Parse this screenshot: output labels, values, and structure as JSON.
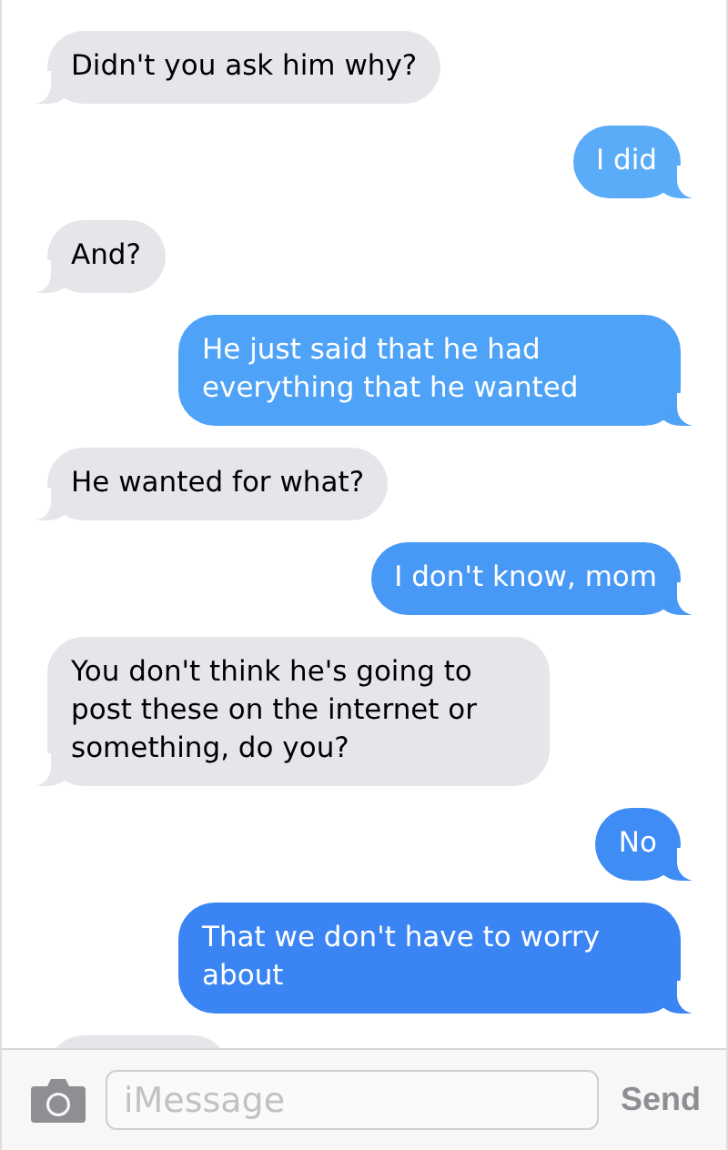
{
  "messages": [
    {
      "text": "Didn't you ask him why?",
      "outgoing": false
    },
    {
      "text": "I did",
      "outgoing": true,
      "color": "#5aacf8"
    },
    {
      "text": "And?",
      "outgoing": false
    },
    {
      "text": "He just said that he had everything that he wanted",
      "outgoing": true,
      "color": "#4ea2f7"
    },
    {
      "text": "He wanted for what?",
      "outgoing": false
    },
    {
      "text": "I don't know, mom",
      "outgoing": true,
      "color": "#4898f6"
    },
    {
      "text": "You don't think he's going to post these on the internet or something, do you?",
      "outgoing": false
    },
    {
      "text": "No",
      "outgoing": true,
      "color": "#3f8cf5"
    },
    {
      "text": "That we don't have to worry about",
      "outgoing": true,
      "color": "#3a84f4"
    },
    {
      "kind": "covered",
      "outgoing": false
    }
  ],
  "composer": {
    "placeholder": "iMessage",
    "send": "Send"
  }
}
